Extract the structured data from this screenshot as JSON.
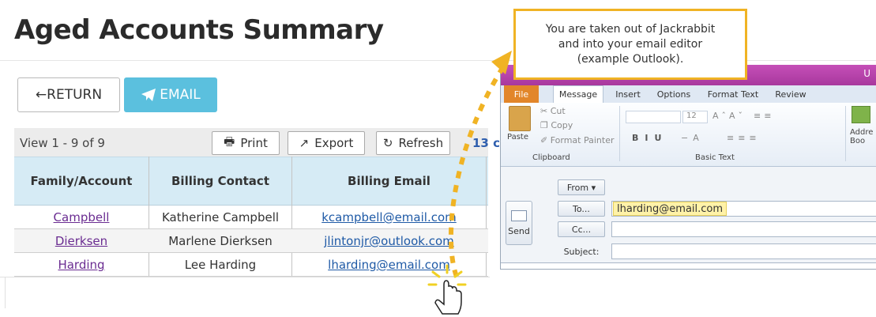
{
  "page": {
    "title": "Aged Accounts Summary"
  },
  "buttons": {
    "return_label": "←RETURN",
    "email_label": "EMAIL"
  },
  "toolbar": {
    "view_count": "View 1 - 9 of 9",
    "print": "Print",
    "export": "Export",
    "refresh": "Refresh",
    "extra": "13 c"
  },
  "table": {
    "headers": [
      "Family/Account",
      "Billing Contact",
      "Billing Email"
    ],
    "rows": [
      {
        "family": "Campbell",
        "contact": "Katherine Campbell",
        "email": "kcampbell@email.com"
      },
      {
        "family": "Dierksen",
        "contact": "Marlene Dierksen",
        "email": "jlintonjr@outlook.com"
      },
      {
        "family": "Harding",
        "contact": "Lee Harding",
        "email": "lharding@email.com"
      }
    ]
  },
  "callout": {
    "text": "You are taken out of Jackrabbit and into your email editor (example Outlook)."
  },
  "outlook": {
    "title_fragment": "U",
    "tabs": [
      "File",
      "Message",
      "Insert",
      "Options",
      "Format Text",
      "Review"
    ],
    "ribbon": {
      "cut": "Cut",
      "copy": "Copy",
      "paste": "Paste",
      "format_painter": "Format Painter",
      "font_size": "12",
      "clipboard": "Clipboard",
      "basic_text": "Basic Text",
      "address_book": "Addre Boo"
    },
    "send": "Send",
    "from": "From ▾",
    "to": "To...",
    "cc": "Cc...",
    "subject": "Subject:",
    "to_value": "lharding@email.com"
  },
  "colors": {
    "email_button": "#5bc0de",
    "callout_border": "#f0b324",
    "outlook_titlebar": "#b544a8",
    "file_tab": "#e2862a",
    "header_bg": "#d6ebf5"
  }
}
